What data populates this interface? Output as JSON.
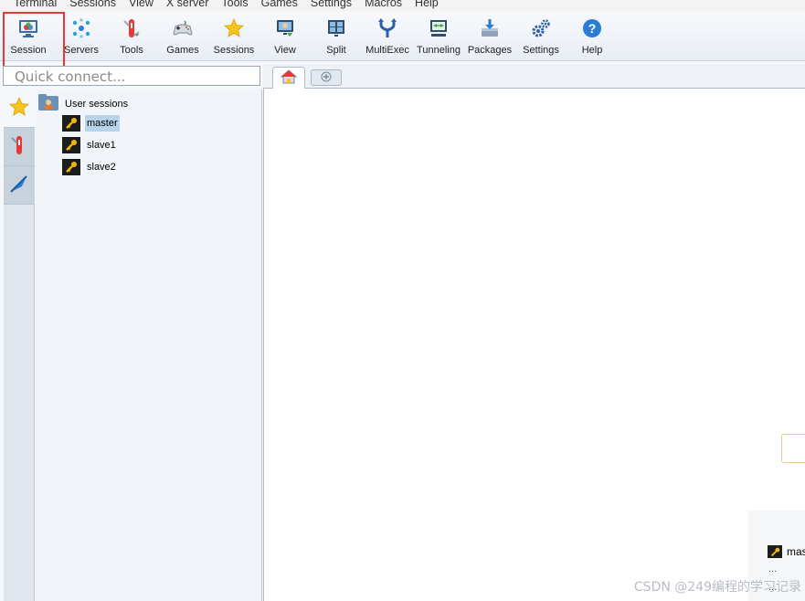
{
  "menu": [
    "Terminal",
    "Sessions",
    "View",
    "X server",
    "Tools",
    "Games",
    "Settings",
    "Macros",
    "Help"
  ],
  "toolbar": [
    {
      "label": "Session",
      "icon": "session-monitor-icon"
    },
    {
      "label": "Servers",
      "icon": "servers-dots-icon"
    },
    {
      "label": "Tools",
      "icon": "tools-knife-icon"
    },
    {
      "label": "Games",
      "icon": "gamepad-icon"
    },
    {
      "label": "Sessions",
      "icon": "star-icon"
    },
    {
      "label": "View",
      "icon": "view-monitor-icon"
    },
    {
      "label": "Split",
      "icon": "split-screen-icon"
    },
    {
      "label": "MultiExec",
      "icon": "fork-icon"
    },
    {
      "label": "Tunneling",
      "icon": "tunneling-icon"
    },
    {
      "label": "Packages",
      "icon": "packages-download-icon"
    },
    {
      "label": "Settings",
      "icon": "gears-icon"
    },
    {
      "label": "Help",
      "icon": "help-question-icon"
    }
  ],
  "quick_connect": {
    "placeholder": "Quick connect..."
  },
  "sidebar": {
    "tabs": [
      "star-icon",
      "tools-knife-icon",
      "paper-plane-icon"
    ],
    "tree": {
      "root": "User sessions",
      "items": [
        {
          "label": "master",
          "selected": true
        },
        {
          "label": "slave1",
          "selected": false
        },
        {
          "label": "slave2",
          "selected": false
        }
      ]
    }
  },
  "recent": {
    "item": "mas",
    "more": "..."
  },
  "watermark": "CSDN @249编程的学习记录",
  "colors": {
    "accent": "#2b7dd3",
    "highlight": "#e53935",
    "selection": "#b8d3ec"
  }
}
